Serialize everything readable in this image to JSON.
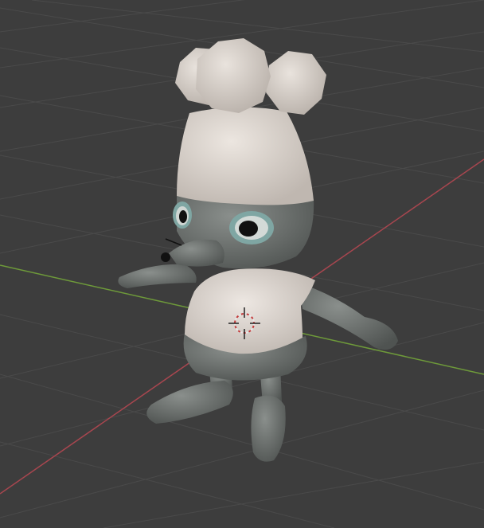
{
  "viewport": {
    "background_color": "#3d3d3d",
    "grid_color": "#4a4a4a",
    "x_axis_color": "#a8464f",
    "y_axis_color": "#6e9a3a"
  },
  "model": {
    "hat_color": "#d9d2cc",
    "shirt_color": "#ddd6d0",
    "body_color": "#6f7471",
    "eye_ring_color": "#7fa6a3",
    "pupil_color": "#111111"
  },
  "origin_cursor": {
    "icon": "3d-cursor-icon"
  }
}
